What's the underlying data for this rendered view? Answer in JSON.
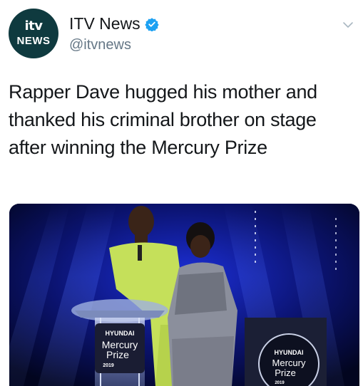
{
  "account": {
    "avatar_brand": "itv",
    "avatar_sub": "NEWS",
    "display_name": "ITV News",
    "handle": "@itvnews"
  },
  "tweet": {
    "text_line1": "Rapper Dave hugged his mother and",
    "text_line2": "thanked his criminal brother on stage",
    "text_line3": "after winning the Mercury Prize"
  },
  "media": {
    "podium_brand": "HYUNDAI",
    "podium_line1": "Mercury",
    "podium_line2": "Prize",
    "podium_year": "2019",
    "trophy_brand": "HYUNDAI",
    "trophy_line1": "Mercury",
    "trophy_line2": "Prize",
    "trophy_year": "2019"
  },
  "colors": {
    "verified_blue": "#1da1f2",
    "avatar_bg": "#0f3a3f",
    "handle_grey": "#657786",
    "stage_blue": "#1e3cff"
  },
  "icons": {
    "verified": "verified-badge-icon",
    "more": "chevron-down-icon"
  }
}
